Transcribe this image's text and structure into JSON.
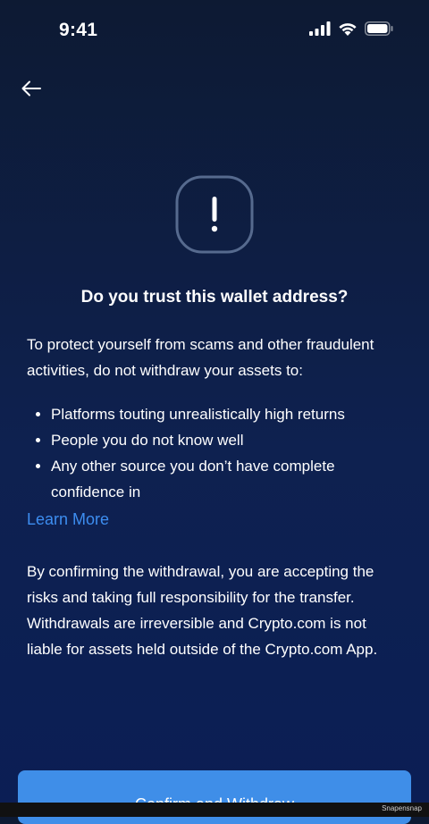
{
  "status_bar": {
    "time": "9:41"
  },
  "nav": {
    "back_icon": "arrow-left-icon"
  },
  "alert": {
    "icon": "exclamation-icon",
    "title": "Do you trust this wallet address?"
  },
  "body": {
    "intro": "To protect yourself from scams and other fraudulent activities, do not withdraw your assets to:",
    "bullets": [
      "Platforms touting unrealistically high returns",
      "People you do not know well",
      "Any other source you don’t have complete confidence in"
    ],
    "learn_more": "Learn More",
    "disclaimer": "By confirming the withdrawal, you are accepting the risks and taking full responsibility for the transfer. Withdrawals are irreversible and Crypto.com is not liable for assets held outside of the Crypto.com App."
  },
  "actions": {
    "confirm_label": "Confirm and Withdraw"
  },
  "watermark": "Snapensnap",
  "colors": {
    "background_top": "#0d1a33",
    "background_bottom": "#0b1e55",
    "accent": "#3f8ee8",
    "link": "#3d8df0"
  }
}
